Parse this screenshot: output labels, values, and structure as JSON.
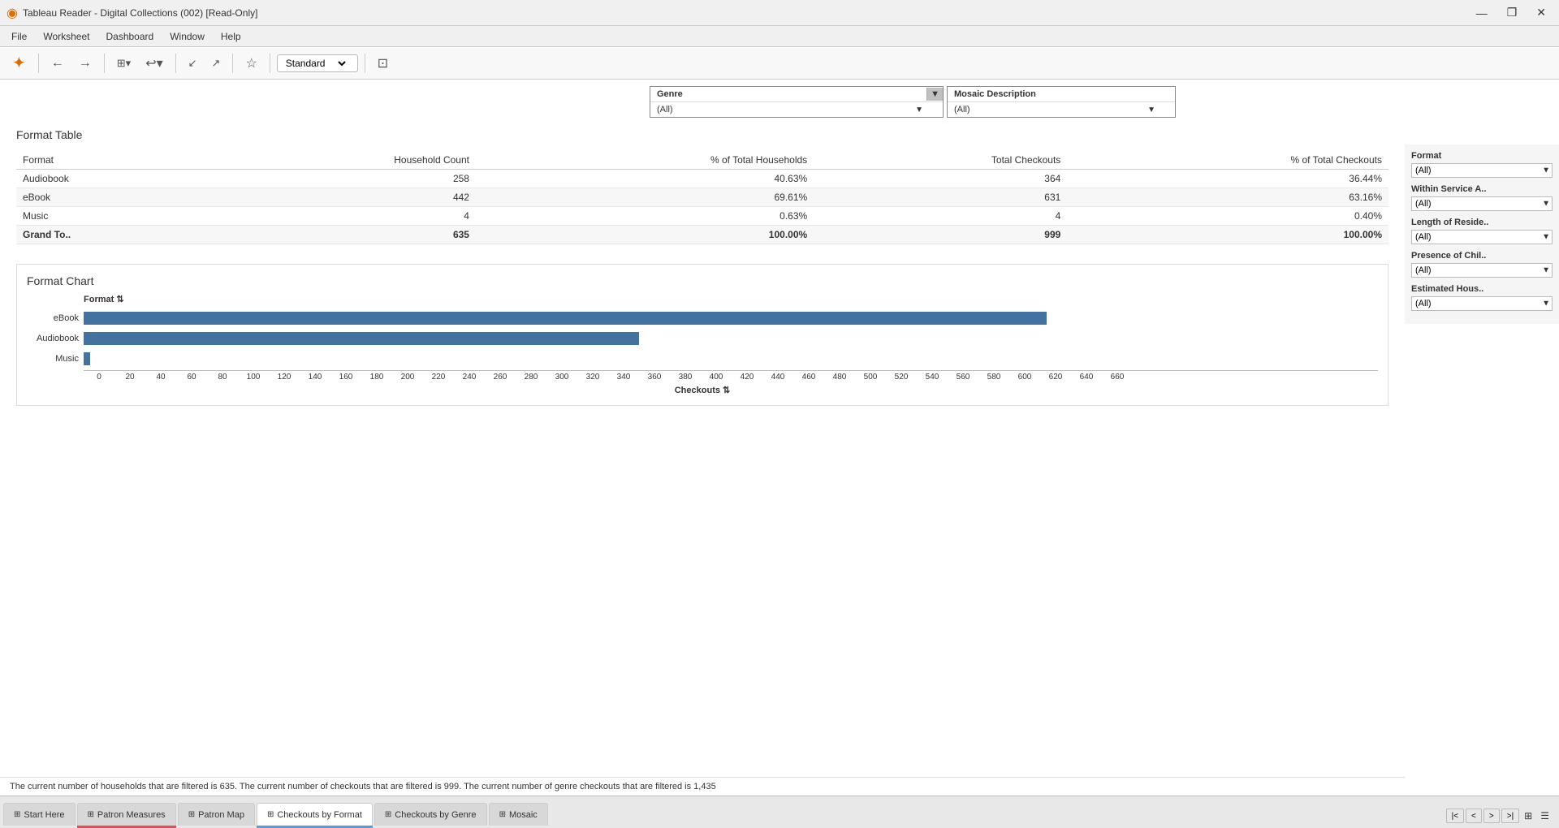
{
  "titleBar": {
    "title": "Tableau Reader - Digital Collections (002) [Read-Only]",
    "appIcon": "◉",
    "minimize": "—",
    "maximize": "❐",
    "close": "✕"
  },
  "menuBar": {
    "items": [
      "File",
      "Worksheet",
      "Dashboard",
      "Window",
      "Help"
    ]
  },
  "toolbar": {
    "view_dropdown": "Standard",
    "buttons": [
      "←",
      "→",
      "⊞",
      "↩",
      "↙",
      "↗",
      "☆",
      "⊡"
    ]
  },
  "pageTitle": "Checkouts by Format",
  "formatTableSection": {
    "title": "Format Table",
    "columns": [
      "Format",
      "Household Count",
      "% of Total Households",
      "Total Checkouts",
      "% of Total Checkouts"
    ],
    "rows": [
      {
        "format": "Audiobook",
        "householdCount": "258",
        "pctHouseholds": "40.63%",
        "totalCheckouts": "364",
        "pctCheckouts": "36.44%"
      },
      {
        "format": "eBook",
        "householdCount": "442",
        "pctHouseholds": "69.61%",
        "totalCheckouts": "631",
        "pctCheckouts": "63.16%"
      },
      {
        "format": "Music",
        "householdCount": "4",
        "pctHouseholds": "0.63%",
        "totalCheckouts": "4",
        "pctCheckouts": "0.40%"
      },
      {
        "format": "Grand To..",
        "householdCount": "635",
        "pctHouseholds": "100.00%",
        "totalCheckouts": "999",
        "pctCheckouts": "100.00%"
      }
    ]
  },
  "formatChartSection": {
    "title": "Format Chart",
    "yAxisLabel": "Format ⇅",
    "xAxisLabel": "Checkouts ⇅",
    "bars": [
      {
        "label": "eBook",
        "value": 631,
        "maxValue": 660,
        "color": "#4472a0"
      },
      {
        "label": "Audiobook",
        "value": 364,
        "maxValue": 660,
        "color": "#4472a0"
      },
      {
        "label": "Music",
        "value": 4,
        "maxValue": 660,
        "color": "#4472a0"
      }
    ],
    "xTicks": [
      "0",
      "20",
      "40",
      "60",
      "80",
      "100",
      "120",
      "140",
      "160",
      "180",
      "200",
      "220",
      "240",
      "260",
      "280",
      "300",
      "320",
      "340",
      "360",
      "380",
      "400",
      "420",
      "440",
      "460",
      "480",
      "500",
      "520",
      "540",
      "560",
      "580",
      "600",
      "620",
      "640",
      "660"
    ]
  },
  "topFilters": {
    "genre": {
      "label": "Genre",
      "value": "(All)"
    },
    "mosaicDescription": {
      "label": "Mosaic Description",
      "value": "(All)"
    }
  },
  "rightFilters": {
    "format": {
      "label": "Format",
      "value": "(All)"
    },
    "withinServiceArea": {
      "label": "Within Service A..",
      "value": "(All)"
    },
    "lengthOfResidence": {
      "label": "Length of Reside..",
      "value": "(All)"
    },
    "presenceOfChildren": {
      "label": "Presence of Chil..",
      "value": "(All)"
    },
    "estimatedHousehold": {
      "label": "Estimated Hous..",
      "value": "(All)"
    }
  },
  "statusBar": {
    "text": "The current number of households that are filtered is 635. The current number of checkouts that are filtered is 999. The current number of genre checkouts that are filtered is 1,435"
  },
  "tabs": [
    {
      "label": "Start Here",
      "icon": "⊞",
      "active": false,
      "indicatorColor": ""
    },
    {
      "label": "Patron Measures",
      "icon": "⊞",
      "active": false,
      "indicatorColor": "red"
    },
    {
      "label": "Patron Map",
      "icon": "⊞",
      "active": false,
      "indicatorColor": ""
    },
    {
      "label": "Checkouts by Format",
      "icon": "⊞",
      "active": true,
      "indicatorColor": "blue"
    },
    {
      "label": "Checkouts by Genre",
      "icon": "⊞",
      "active": false,
      "indicatorColor": ""
    },
    {
      "label": "Mosaic",
      "icon": "⊞",
      "active": false,
      "indicatorColor": ""
    }
  ],
  "bottomNav": {
    "buttons": [
      "|<",
      "<",
      ">",
      ">|"
    ]
  }
}
